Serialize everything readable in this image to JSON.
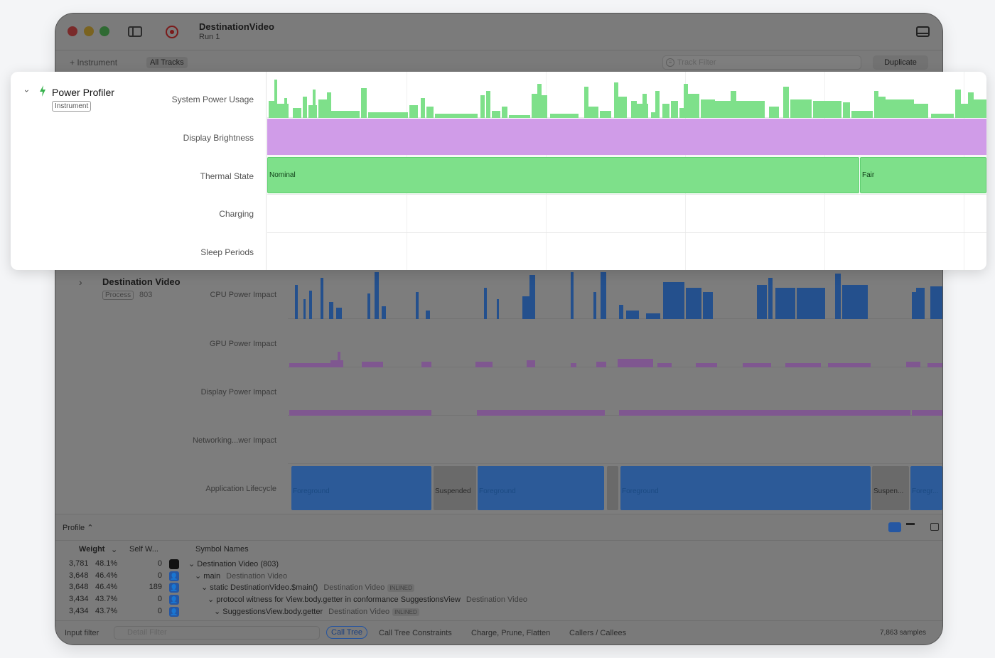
{
  "window": {
    "title": "DestinationVideo",
    "subtitle": "Run 1"
  },
  "toolbar": {
    "add_instrument": "+ Instrument",
    "all_tracks": "All Tracks",
    "track_filter_placeholder": "Track Filter",
    "duplicate": "Duplicate"
  },
  "power_profiler": {
    "name": "Power Profiler",
    "badge": "Instrument",
    "tracks": [
      "System Power Usage",
      "Display Brightness",
      "Thermal State",
      "Charging",
      "Sleep Periods"
    ],
    "thermal_states": [
      "Nominal",
      "Fair"
    ],
    "colors": {
      "power": "#7ee08a",
      "brightness": "#d09ce8",
      "thermal": "#7ee08a"
    }
  },
  "destination_video": {
    "name": "Destination Video",
    "badge": "Process",
    "pid": "803",
    "tracks": [
      "CPU Power Impact",
      "GPU Power Impact",
      "Display Power Impact",
      "Networking...wer Impact",
      "Application Lifecycle"
    ],
    "lifecycle": [
      "Foreground",
      "Suspended",
      "Foreground",
      "Foreground",
      "Suspen...",
      "Foregr..."
    ]
  },
  "detail": {
    "profile_label": "Profile ⌃",
    "columns": {
      "weight": "Weight",
      "self": "Self W...",
      "symbol": "Symbol Names"
    },
    "rows": [
      {
        "weight": "3,781",
        "pct": "48.1%",
        "self": "0",
        "symbol": "Destination Video (803)",
        "lib": "",
        "tag": ""
      },
      {
        "weight": "3,648",
        "pct": "46.4%",
        "self": "0",
        "symbol": "main",
        "lib": "Destination Video",
        "tag": ""
      },
      {
        "weight": "3,648",
        "pct": "46.4%",
        "self": "189",
        "symbol": "static DestinationVideo.$main()",
        "lib": "Destination Video",
        "tag": "INLINED"
      },
      {
        "weight": "3,434",
        "pct": "43.7%",
        "self": "0",
        "symbol": "protocol witness for View.body.getter in conformance SuggestionsView",
        "lib": "Destination Video",
        "tag": ""
      },
      {
        "weight": "3,434",
        "pct": "43.7%",
        "self": "0",
        "symbol": "SuggestionsView.body.getter",
        "lib": "Destination Video",
        "tag": "INLINED"
      }
    ]
  },
  "footer": {
    "input_filter": "Input filter",
    "detail_filter_placeholder": "Detail Filter",
    "call_tree": "Call Tree",
    "constraints": "Call Tree Constraints",
    "charge": "Charge, Prune, Flatten",
    "callers": "Callers / Callees",
    "samples": "7,863 samples"
  }
}
